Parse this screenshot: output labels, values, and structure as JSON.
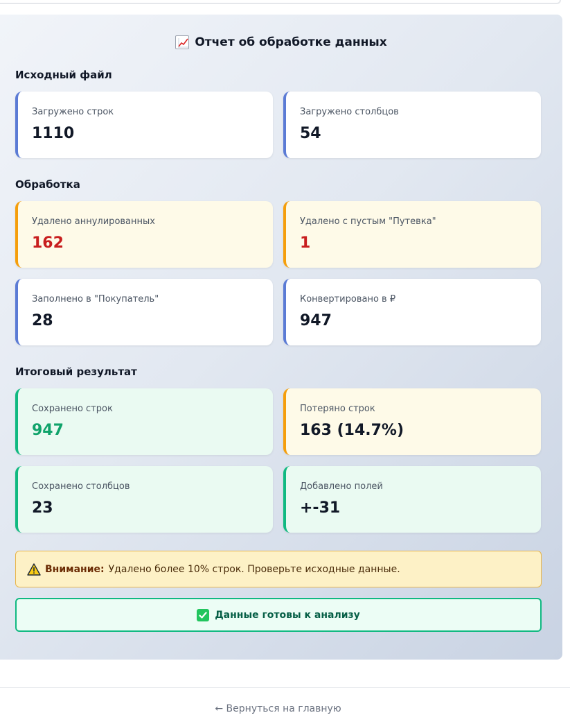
{
  "report": {
    "title": "Отчет об обработке данных",
    "title_icon": "chart-increasing-icon"
  },
  "source": {
    "heading": "Исходный файл",
    "cards": [
      {
        "label": "Загружено строк",
        "value": "1110"
      },
      {
        "label": "Загружено столбцов",
        "value": "54"
      }
    ]
  },
  "processing": {
    "heading": "Обработка",
    "cards": [
      {
        "label": "Удалено аннулированных",
        "value": "162"
      },
      {
        "label": "Удалено с пустым \"Путевка\"",
        "value": "1"
      },
      {
        "label": "Заполнено в \"Покупатель\"",
        "value": "28"
      },
      {
        "label": "Конвертировано в ₽",
        "value": "947"
      }
    ]
  },
  "result": {
    "heading": "Итоговый результат",
    "cards": [
      {
        "label": "Сохранено строк",
        "value": "947"
      },
      {
        "label": "Потеряно строк",
        "value": "163 (14.7%)"
      },
      {
        "label": "Сохранено столбцов",
        "value": "23"
      },
      {
        "label": "Добавлено полей",
        "value": "+-31"
      }
    ]
  },
  "alert": {
    "strong": "Внимание:",
    "text": "Удалено более 10% строк. Проверьте исходные данные.",
    "icon": "warning-icon"
  },
  "status": {
    "text": "Данные готовы к анализу",
    "icon": "check-mark-icon"
  },
  "footer": {
    "back_link": "← Вернуться на главную"
  },
  "colors": {
    "accent_blue": "#5b7bd5",
    "warning_orange": "#f59e0b",
    "success_green": "#10b981",
    "danger_red": "#c81e1e"
  }
}
